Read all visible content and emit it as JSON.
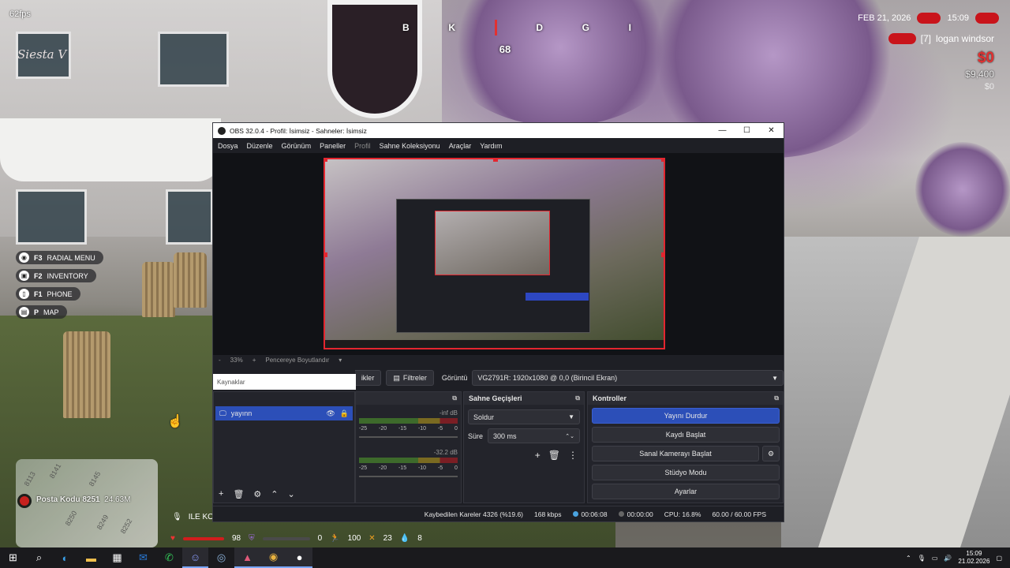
{
  "game": {
    "fps": "62fps",
    "logo": "Siesta V",
    "compass": [
      "B",
      "K",
      "D",
      "G",
      "I"
    ],
    "heading": "68",
    "date": "FEB 21, 2026",
    "time": "15:09",
    "player_tag": "[7]",
    "player_name": "logan windsor",
    "cash": "$0",
    "bank": "$9,400",
    "extra": "$0",
    "hotkeys": [
      {
        "key": "F3",
        "label": "RADIAL MENU",
        "icon": "radial-icon"
      },
      {
        "key": "F2",
        "label": "INVENTORY",
        "icon": "inventory-icon"
      },
      {
        "key": "F1",
        "label": "PHONE",
        "icon": "phone-icon"
      },
      {
        "key": "P",
        "label": "MAP",
        "icon": "map-icon"
      }
    ],
    "postal": "Posta Kodu 8251",
    "distance": "24.63M",
    "ile_text": "ILE KO",
    "stats": {
      "health": "98",
      "armor": "0",
      "stamina": "100",
      "hunger": "23",
      "thirst": "8"
    },
    "minimap_numbers": [
      "8113",
      "8141",
      "8145",
      "8250",
      "8249",
      "8252"
    ]
  },
  "obs": {
    "title": "OBS 32.0.4 - Profil: İsimsiz - Sahneler: İsimsiz",
    "menu": [
      "Dosya",
      "Düzenle",
      "Görünüm",
      "Paneller",
      "Profil",
      "Sahne Koleksiyonu",
      "Araçlar",
      "Yardım"
    ],
    "zoom": "33%",
    "zoom_minus": "-",
    "zoom_plus": "+",
    "fit_label": "Pencereye Boyutlandır",
    "source_bar": {
      "props_label": "Özellikler",
      "props_label_visible": "ikler",
      "filters_label": "Filtreler",
      "display_label": "Görüntü",
      "display_value": "VG2791R: 1920x1080 @ 0,0 (Birincil Ekran)"
    },
    "tooltip": "Kaynaklar",
    "sources": {
      "items": [
        {
          "name": "yayınn"
        }
      ]
    },
    "audio": {
      "mixers": [
        {
          "db": "-inf dB",
          "scale": [
            "-25",
            "-20",
            "-15",
            "-10",
            "-5",
            "0"
          ]
        },
        {
          "db": "-32.2 dB",
          "scale": [
            "-25",
            "-20",
            "-15",
            "-10",
            "-5",
            "0"
          ]
        }
      ]
    },
    "transitions": {
      "title": "Sahne Geçişleri",
      "selected": "Soldur",
      "duration_label": "Süre",
      "duration": "300 ms"
    },
    "controls": {
      "title": "Kontroller",
      "stop_stream": "Yayını Durdur",
      "start_record": "Kaydı Başlat",
      "start_vcam": "Sanal Kamerayı Başlat",
      "studio_mode": "Stüdyo Modu",
      "settings": "Ayarlar"
    },
    "status": {
      "dropped": "Kaybedilen Kareler 4326 (%19.6)",
      "bitrate": "168 kbps",
      "stream_time": "00:06:08",
      "rec_time": "00:00:00",
      "cpu": "CPU: 16.8%",
      "fps": "60.00 / 60.00 FPS"
    }
  },
  "taskbar": {
    "apps": [
      "windows-icon",
      "search-icon",
      "edge-icon",
      "explorer-icon",
      "store-icon",
      "outlook-icon",
      "whatsapp-icon",
      "discord-icon",
      "steam-icon",
      "game-icon",
      "chrome-icon",
      "obs-icon"
    ],
    "time": "15:09",
    "date": "21.02.2026"
  }
}
